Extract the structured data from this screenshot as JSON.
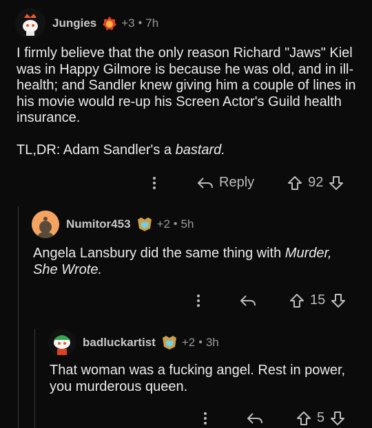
{
  "comments": [
    {
      "username": "Jungies",
      "score_delta": "+3",
      "time": "7h",
      "paragraphs": [
        "I firmly believe that the only reason Richard \"Jaws\" Kiel was in Happy Gilmore is because he was old, and in ill-health; and Sandler knew giving him a couple of lines in his movie would re-up his Screen Actor's Guild health insurance.",
        "TL,DR: Adam Sandler's a "
      ],
      "italic_tail": "bastard.",
      "reply_label": "Reply",
      "votes": "92"
    },
    {
      "username": "Numitor453",
      "score_delta": "+2",
      "time": "5h",
      "text_before": "Angela Lansbury did the same thing with ",
      "italic_tail": "Murder, She Wrote.",
      "votes": "15"
    },
    {
      "username": "badluckartist",
      "score_delta": "+2",
      "time": "3h",
      "text": "That woman was a fucking angel. Rest in power, you murderous queen.",
      "votes": "5"
    }
  ],
  "icons": {
    "more": "more-vertical-icon",
    "reply": "reply-arrow-icon",
    "upvote": "upvote-arrow-icon",
    "downvote": "downvote-arrow-icon",
    "award": "award-badge-icon"
  },
  "colors": {
    "background": "#0b0b0b",
    "text": "#ececec",
    "meta": "#9a9a9a",
    "thread_line": "#3a3a3a",
    "avatar_orange": "#f4a460"
  }
}
